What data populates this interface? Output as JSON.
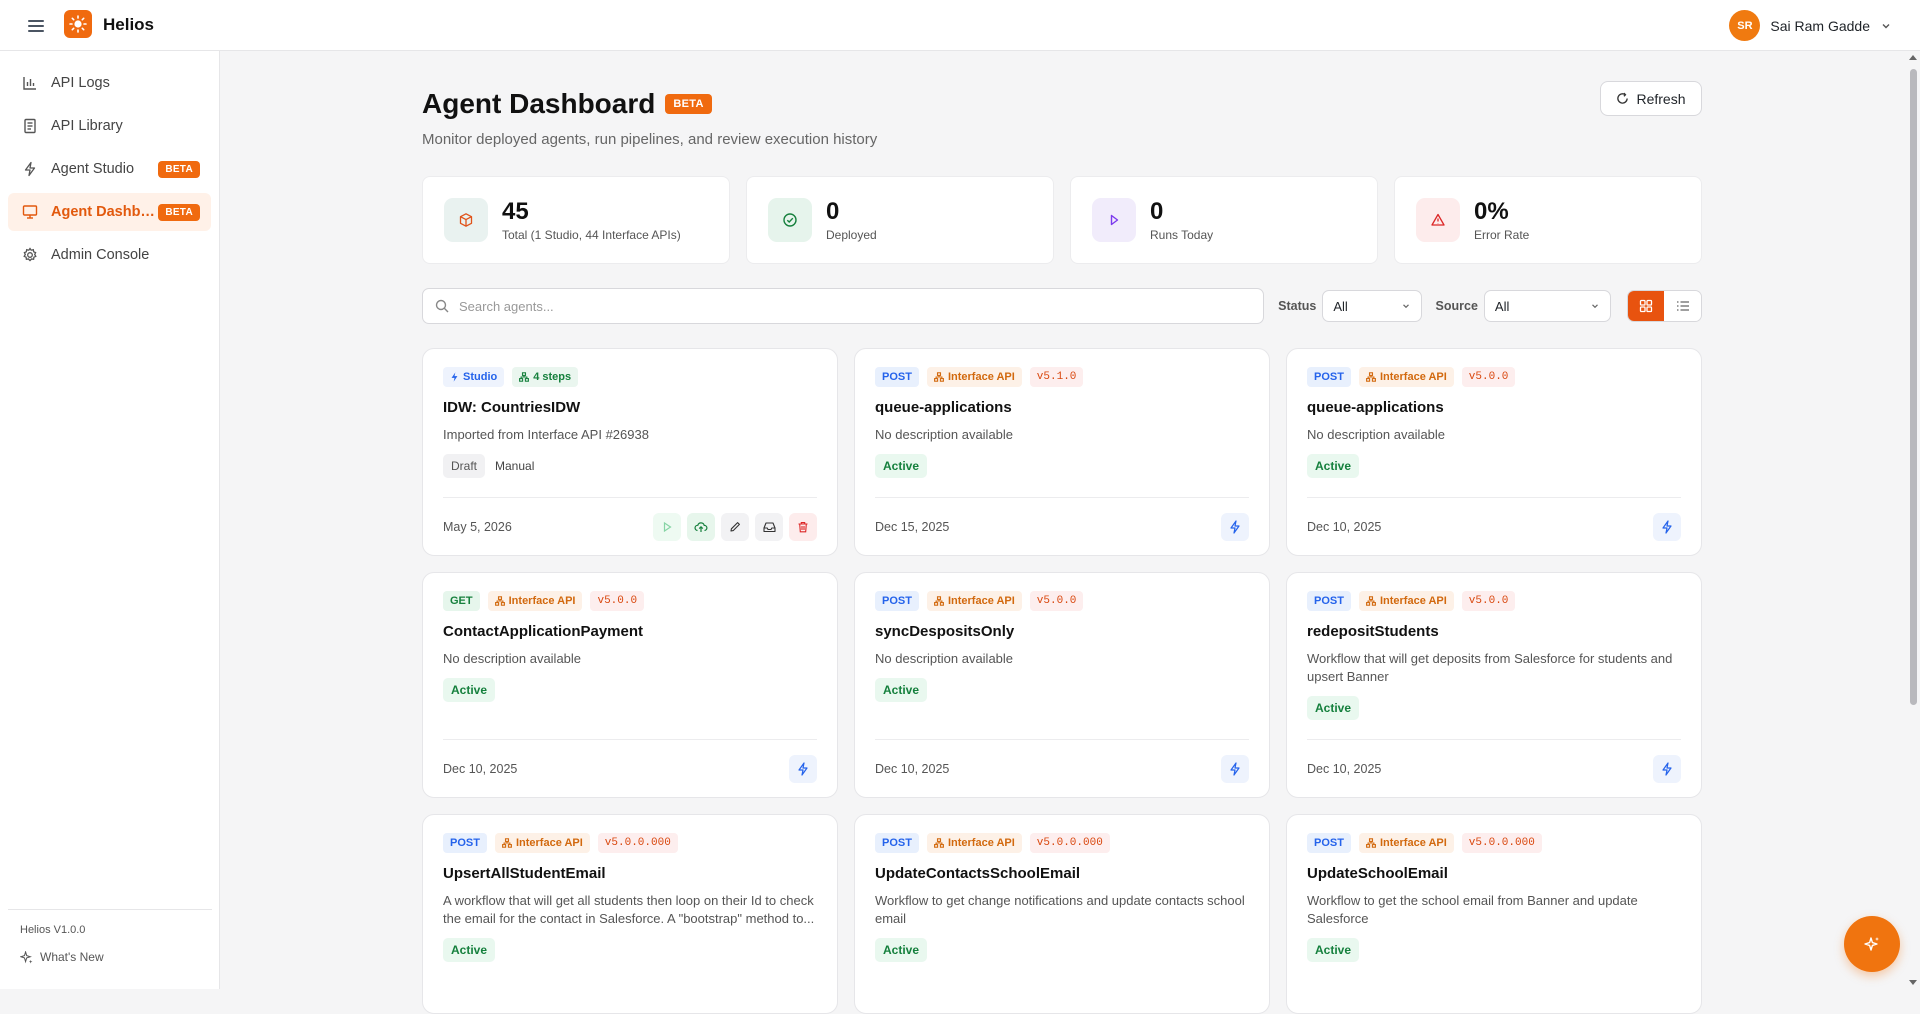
{
  "app": {
    "name": "Helios"
  },
  "user": {
    "initials": "SR",
    "name": "Sai Ram Gadde"
  },
  "sidebar": {
    "items": [
      {
        "label": "API Logs",
        "icon": "bar-chart-icon"
      },
      {
        "label": "API Library",
        "icon": "book-icon"
      },
      {
        "label": "Agent Studio",
        "icon": "bolt-icon",
        "badge": "BETA"
      },
      {
        "label": "Agent Dashboard",
        "icon": "monitor-icon",
        "badge": "BETA",
        "active": true
      },
      {
        "label": "Admin Console",
        "icon": "gear-icon"
      }
    ],
    "version": "Helios V1.0.0",
    "whats_new": "What's New"
  },
  "page": {
    "title": "Agent Dashboard",
    "badge": "BETA",
    "subtitle": "Monitor deployed agents, run pipelines, and review execution history",
    "refresh_label": "Refresh"
  },
  "stats": [
    {
      "value": "45",
      "label": "Total (1 Studio, 44 Interface APIs)",
      "icon": "cube-icon"
    },
    {
      "value": "0",
      "label": "Deployed",
      "icon": "check-circle-icon"
    },
    {
      "value": "0",
      "label": "Runs Today",
      "icon": "play-icon"
    },
    {
      "value": "0%",
      "label": "Error Rate",
      "icon": "warning-icon"
    }
  ],
  "filters": {
    "search_placeholder": "Search agents...",
    "status_label": "Status",
    "status_value": "All",
    "source_label": "Source",
    "source_value": "All",
    "view": "grid"
  },
  "cards": [
    {
      "studio": true,
      "source": "Studio",
      "steps": "4 steps",
      "title": "IDW: CountriesIDW",
      "desc": "Imported from Interface API #26938",
      "status": "Draft",
      "trigger": "Manual",
      "date": "May 5, 2026"
    },
    {
      "method": "POST",
      "source": "Interface API",
      "version": "v5.1.0",
      "title": "queue-applications",
      "desc": "No description available",
      "status": "Active",
      "date": "Dec 15, 2025"
    },
    {
      "method": "POST",
      "source": "Interface API",
      "version": "v5.0.0",
      "title": "queue-applications",
      "desc": "No description available",
      "status": "Active",
      "date": "Dec 10, 2025"
    },
    {
      "method": "GET",
      "source": "Interface API",
      "version": "v5.0.0",
      "title": "ContactApplicationPayment",
      "desc": "No description available",
      "status": "Active",
      "date": "Dec 10, 2025"
    },
    {
      "method": "POST",
      "source": "Interface API",
      "version": "v5.0.0",
      "title": "syncDespositsOnly",
      "desc": "No description available",
      "status": "Active",
      "date": "Dec 10, 2025"
    },
    {
      "method": "POST",
      "source": "Interface API",
      "version": "v5.0.0",
      "title": "redepositStudents",
      "desc": "Workflow that will get deposits from Salesforce for students and upsert Banner",
      "status": "Active",
      "date": "Dec 10, 2025"
    },
    {
      "method": "POST",
      "source": "Interface API",
      "version": "v5.0.0.000",
      "title": "UpsertAllStudentEmail",
      "desc": "A workflow that will get all students then loop on their Id to check the email for the contact in Salesforce. A \"bootstrap\" method to...",
      "status": "Active"
    },
    {
      "method": "POST",
      "source": "Interface API",
      "version": "v5.0.0.000",
      "title": "UpdateContactsSchoolEmail",
      "desc": "Workflow to get change notifications and update contacts school email",
      "status": "Active"
    },
    {
      "method": "POST",
      "source": "Interface API",
      "version": "v5.0.0.000",
      "title": "UpdateSchoolEmail",
      "desc": "Workflow to get the school email from Banner and update Salesforce",
      "status": "Active"
    }
  ],
  "colors": {
    "accent": "#f06a0f",
    "active_nav": "#e2590d",
    "post": "#2563eb",
    "get": "#16803d",
    "active": "#15803d"
  }
}
